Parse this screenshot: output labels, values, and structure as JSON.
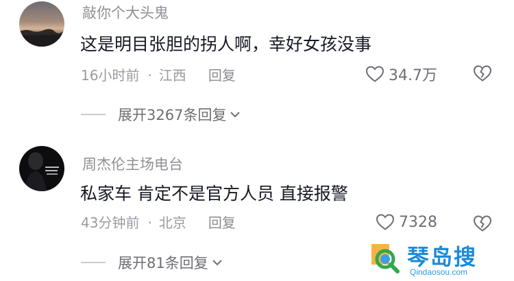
{
  "comments": [
    {
      "username": "敲你个大头鬼",
      "content": "这是明目张胆的拐人啊，幸好女孩没事",
      "time": "16小时前",
      "separator": "·",
      "location": "江西",
      "reply_label": "回复",
      "likes": "34.7万",
      "expand_label": "展开3267条回复"
    },
    {
      "username": "周杰伦主场电台",
      "content": "私家车  肯定不是官方人员 直接报警",
      "time": "43分钟前",
      "separator": "·",
      "location": "北京",
      "reply_label": "回复",
      "likes": "7328",
      "expand_label": "展开81条回复"
    }
  ],
  "watermark": {
    "title": "琴岛搜",
    "url": "Qindaosou.com"
  }
}
